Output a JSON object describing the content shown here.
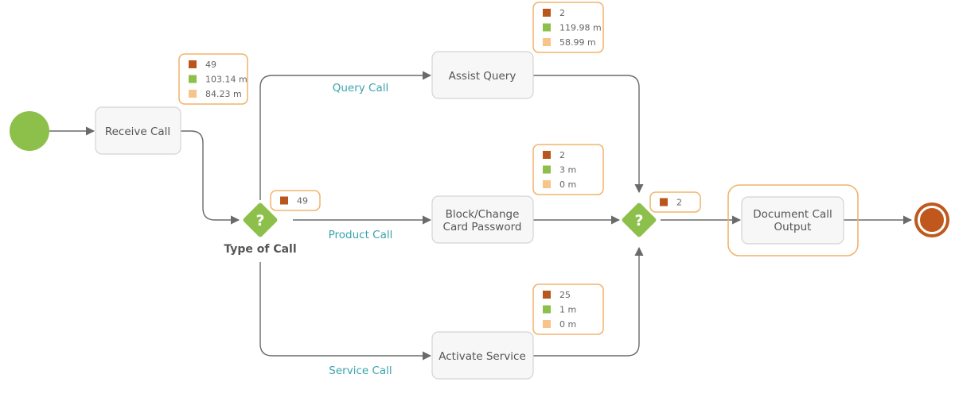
{
  "colors": {
    "start": "#8dc04a",
    "gateway": "#8dc04a",
    "count": "#b9561d",
    "duration_avg": "#8dc04a",
    "duration_other": "#f7c48a",
    "highlight": "#f0b36c",
    "end": "#c0581d",
    "flow_label": "#3aa3ad"
  },
  "start_event": {
    "icon": "start-circle"
  },
  "tasks": {
    "receive": "Receive Call",
    "assist": "Assist Query",
    "block_l1": "Block/Change",
    "block_l2": "Card Password",
    "activate": "Activate Service",
    "document_l1": "Document Call",
    "document_l2": "Output"
  },
  "gateways": {
    "split_label": "Type of Call",
    "split_icon": "?",
    "join_icon": "?"
  },
  "flows": {
    "query": "Query Call",
    "product": "Product Call",
    "service": "Service Call"
  },
  "stats": {
    "receive": [
      "49",
      "103.14 m",
      "84.23 m"
    ],
    "split": [
      "49"
    ],
    "assist": [
      "2",
      "119.98 m",
      "58.99 m"
    ],
    "block": [
      "2",
      "3 m",
      "0 m"
    ],
    "activate": [
      "25",
      "1 m",
      "0 m"
    ],
    "join": [
      "2"
    ]
  },
  "end_event": {
    "icon": "end-circle"
  }
}
